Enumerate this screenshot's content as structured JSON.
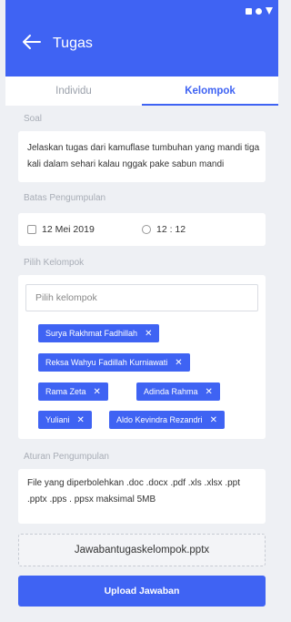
{
  "header": {
    "title": "Tugas"
  },
  "tabs": [
    {
      "label": "Individu"
    },
    {
      "label": "Kelompok"
    }
  ],
  "soal": {
    "label": "Soal",
    "text": "Jelaskan tugas dari kamuflase tumbuhan yang mandi tiga kali dalam sehari kalau nggak pake sabun mandi"
  },
  "batas": {
    "label": "Batas Pengumpulan",
    "date": "12 Mei 2019",
    "time": "12 : 12"
  },
  "kelompok": {
    "label": "Pilih Kelompok",
    "placeholder": "Pilih kelompok",
    "chips": [
      {
        "name": "Surya Rakhmat Fadhillah"
      },
      {
        "name": "Reksa Wahyu Fadillah Kurniawati"
      },
      {
        "name": "Rama Zeta"
      },
      {
        "name": "Adinda Rahma"
      },
      {
        "name": "Yuliani"
      },
      {
        "name": "Aldo Kevindra Rezandri"
      }
    ]
  },
  "aturan": {
    "label": "Aturan Pengumpulan",
    "text": "File yang diperbolehkan .doc .docx .pdf .xls .xlsx .ppt .pptx .pps . ppsx maksimal 5MB"
  },
  "file": {
    "name": "Jawabantugaskelompok.pptx"
  },
  "upload": {
    "label": "Upload Jawaban"
  },
  "colors": {
    "primary": "#3f63f3",
    "background": "#eef0f4"
  }
}
